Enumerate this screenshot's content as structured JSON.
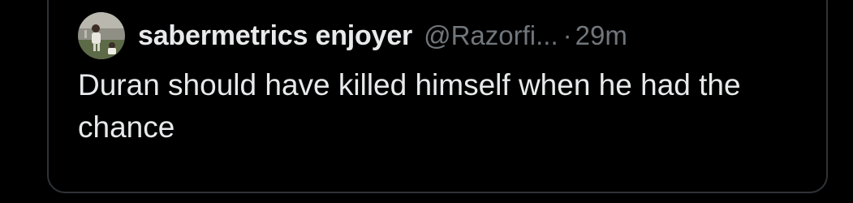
{
  "quote": {
    "author": {
      "display_name": "sabermetrics enjoyer",
      "handle": "@Razorfi...",
      "separator": "·",
      "time": "29m",
      "avatar": "baseball-photo-avatar"
    },
    "text": "Duran should have killed himself when he had the chance"
  },
  "colors": {
    "background": "#000000",
    "border": "#2f3336",
    "primary_text": "#e7e9ea",
    "secondary_text": "#71767b"
  }
}
